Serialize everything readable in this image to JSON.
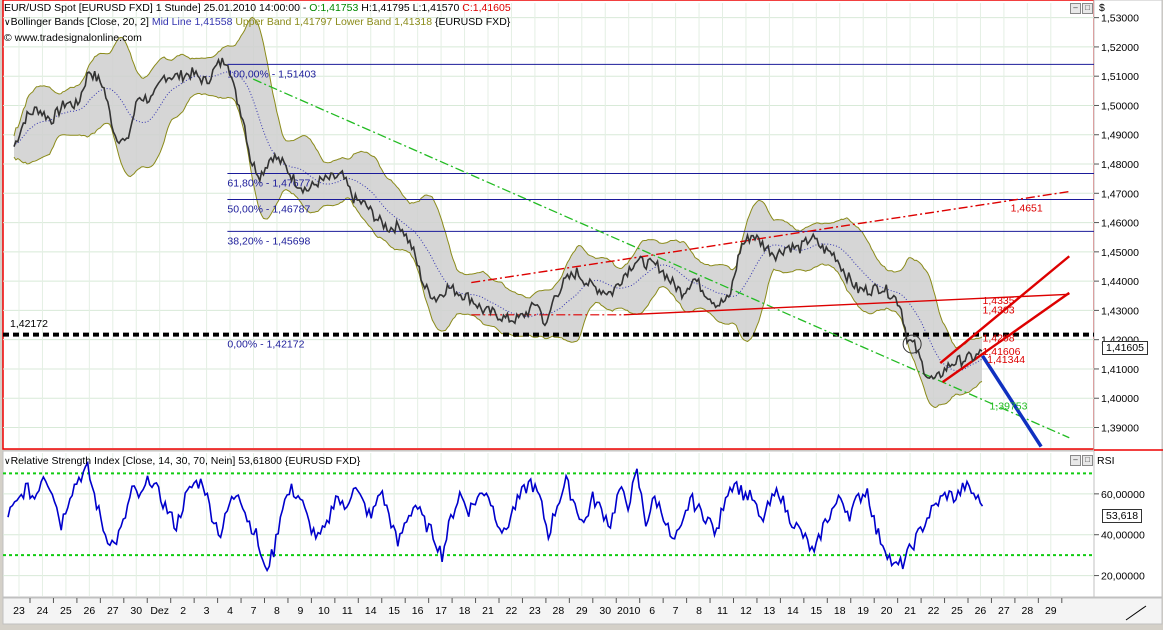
{
  "colors": {
    "price": "#333333",
    "band_fill": "#cfcfcf",
    "band_line": "#8b8b1a",
    "mid_line": "#3535b0",
    "fib_line": "#1b1b9a",
    "fib_text": "#1b1b9a",
    "red": "#dd0000",
    "green_dash": "#22bb22",
    "rsi": "#0000cc",
    "rsi_levels": "#11cc11",
    "blue_arrow": "#1030c0",
    "frame_red": "#ee0000"
  },
  "header": {
    "title_line": "EUR/USD Spot [EURUSD FXD]  1 Stunde] 25.01.2010 14:00:00 - ",
    "o_label": "O:",
    "o_value": "1,41753",
    "h_text": " H:1,41795 L:1,41570 ",
    "c_label": "C:",
    "c_value": "1,41605",
    "bb_prefix": "Bollinger Bands [Close, 20, 2] ",
    "bb_mid": "Mid Line 1,41558",
    "bb_upper": "Upper Band 1,41797",
    "bb_lower": "Lower Band 1,41318",
    "bb_suffix": " {EURUSD FXD}",
    "website": "www.tradesignalonline.com",
    "currency": "$"
  },
  "rsi_header": {
    "text": "Relative Strength Index [Close, 14, 30, 70, Nein] 53,61800 {EURUSD FXD}",
    "axis_title": "RSI"
  },
  "chart_data": [
    {
      "type": "line",
      "title": "EUR/USD Spot [EURUSD FXD] 1 Stunde",
      "ylim": [
        1.383,
        1.535
      ],
      "y_ticks": [
        "1,53000",
        "1,52000",
        "1,51000",
        "1,50000",
        "1,49000",
        "1,48000",
        "1,47000",
        "1,46000",
        "1,45000",
        "1,44000",
        "1,43000",
        "1,42000",
        "1,41000",
        "1,40000",
        "1,39000"
      ],
      "x_ticks": [
        "23",
        "24",
        "25",
        "26",
        "27",
        "30",
        "Dez",
        "2",
        "3",
        "4",
        "7",
        "8",
        "9",
        "10",
        "11",
        "14",
        "15",
        "16",
        "17",
        "18",
        "21",
        "22",
        "23",
        "28",
        "29",
        "30",
        "2010",
        "6",
        "7",
        "8",
        "11",
        "12",
        "13",
        "14",
        "15",
        "18",
        "19",
        "20",
        "21",
        "22",
        "25",
        "26",
        "27",
        "28",
        "29"
      ],
      "last_price": "1,41605",
      "price_path": [
        [
          0,
          1.486
        ],
        [
          0.5,
          1.496
        ],
        [
          1,
          1.499
        ],
        [
          1.6,
          1.495
        ],
        [
          2.2,
          1.501
        ],
        [
          2.7,
          1.5
        ],
        [
          3.2,
          1.512
        ],
        [
          3.8,
          1.507
        ],
        [
          4.3,
          1.49
        ],
        [
          4.8,
          1.487
        ],
        [
          5.3,
          1.503
        ],
        [
          5.9,
          1.502
        ],
        [
          6.4,
          1.51
        ],
        [
          7,
          1.51
        ],
        [
          7.6,
          1.511
        ],
        [
          8.2,
          1.508
        ],
        [
          8.7,
          1.514
        ],
        [
          9.1,
          1.516
        ],
        [
          9.4,
          1.505
        ],
        [
          9.8,
          1.495
        ],
        [
          10.1,
          1.481
        ],
        [
          10.5,
          1.476
        ],
        [
          11,
          1.483
        ],
        [
          11.5,
          1.48
        ],
        [
          12,
          1.474
        ],
        [
          12.5,
          1.471
        ],
        [
          13,
          1.474
        ],
        [
          13.5,
          1.475
        ],
        [
          14,
          1.476
        ],
        [
          14.5,
          1.468
        ],
        [
          15,
          1.466
        ],
        [
          15.5,
          1.461
        ],
        [
          16,
          1.458
        ],
        [
          16.5,
          1.459
        ],
        [
          17,
          1.451
        ],
        [
          17.5,
          1.438
        ],
        [
          18,
          1.434
        ],
        [
          18.5,
          1.438
        ],
        [
          19,
          1.436
        ],
        [
          19.5,
          1.434
        ],
        [
          20,
          1.43
        ],
        [
          20.5,
          1.429
        ],
        [
          21,
          1.427
        ],
        [
          21.5,
          1.427
        ],
        [
          22,
          1.43
        ],
        [
          22.3,
          1.433
        ],
        [
          22.7,
          1.424
        ],
        [
          23,
          1.434
        ],
        [
          23.5,
          1.44
        ],
        [
          24,
          1.443
        ],
        [
          24.5,
          1.439
        ],
        [
          25,
          1.437
        ],
        [
          25.5,
          1.436
        ],
        [
          26,
          1.442
        ],
        [
          26.5,
          1.447
        ],
        [
          27,
          1.446
        ],
        [
          27.5,
          1.445
        ],
        [
          28,
          1.44
        ],
        [
          28.5,
          1.436
        ],
        [
          29,
          1.441
        ],
        [
          29.5,
          1.436
        ],
        [
          30,
          1.432
        ],
        [
          30.5,
          1.434
        ],
        [
          31,
          1.452
        ],
        [
          31.5,
          1.456
        ],
        [
          32,
          1.452
        ],
        [
          32.5,
          1.449
        ],
        [
          33,
          1.452
        ],
        [
          33.5,
          1.451
        ],
        [
          34,
          1.455
        ],
        [
          34.5,
          1.451
        ],
        [
          35,
          1.449
        ],
        [
          35.5,
          1.442
        ],
        [
          36,
          1.437
        ],
        [
          36.5,
          1.437
        ],
        [
          37,
          1.438
        ],
        [
          37.5,
          1.435
        ],
        [
          37.8,
          1.432
        ],
        [
          38.1,
          1.42
        ],
        [
          38.4,
          1.418
        ],
        [
          38.7,
          1.412
        ],
        [
          39,
          1.407
        ],
        [
          39.3,
          1.406
        ],
        [
          39.6,
          1.409
        ],
        [
          40,
          1.412
        ],
        [
          40.4,
          1.413
        ],
        [
          40.8,
          1.414
        ],
        [
          41,
          1.414
        ],
        [
          41.3,
          1.416
        ]
      ],
      "fibonacci_levels": [
        {
          "label": "100,00% - 1,51403",
          "value": 1.51403
        },
        {
          "label": "61,80% - 1,47677",
          "value": 1.47677
        },
        {
          "label": "50,00% - 1,46787",
          "value": 1.46787
        },
        {
          "label": "38,20% - 1,45698",
          "value": 1.45698
        },
        {
          "label": "0,00% - 1,42172",
          "value": 1.42172
        }
      ],
      "horizontal_level": {
        "label": "1,42172",
        "value": 1.42172
      },
      "annotations": [
        "1,4651",
        "1,4335",
        "1,4303",
        "1,4208",
        "1,41606",
        "1,41344",
        "1,39753"
      ],
      "green_trendline": {
        "from": [
          10.2,
          1.509
        ],
        "to": [
          45,
          1.3865
        ]
      },
      "red_dashdot_line": {
        "from": [
          19.5,
          1.4395
        ],
        "to": [
          45,
          1.4706
        ]
      },
      "red_channel_line": {
        "from": [
          26,
          1.4285
        ],
        "to": [
          45,
          1.4355
        ]
      },
      "red_bold_upper": {
        "from": [
          39.5,
          1.412
        ],
        "to": [
          45,
          1.4485
        ]
      },
      "red_bold_lower": {
        "from": [
          39.6,
          1.4055
        ],
        "to": [
          45,
          1.436
        ]
      },
      "blue_arrow": {
        "from": [
          41.3,
          1.4145
        ],
        "to": [
          43.8,
          1.3835
        ]
      }
    },
    {
      "type": "line",
      "title": "Relative Strength Index [Close, 14, 30, 70, Nein]",
      "ylim": [
        10,
        80
      ],
      "y_ticks": [
        "60,00000",
        "40,00000",
        "20,00000"
      ],
      "levels": [
        30,
        70
      ],
      "last_value": "53,618",
      "values": [
        50,
        55,
        63,
        58,
        70,
        62,
        45,
        60,
        68,
        72,
        55,
        40,
        35,
        45,
        62,
        58,
        68,
        60,
        52,
        44,
        58,
        65,
        66,
        50,
        40,
        55,
        62,
        48,
        40,
        22,
        32,
        55,
        62,
        58,
        45,
        38,
        44,
        60,
        52,
        64,
        56,
        48,
        62,
        50,
        35,
        48,
        55,
        46,
        40,
        30,
        48,
        60,
        52,
        58,
        62,
        50,
        40,
        52,
        60,
        66,
        58,
        40,
        55,
        66,
        55,
        45,
        58,
        52,
        45,
        62,
        55,
        70,
        46,
        58,
        50,
        36,
        42,
        58,
        52,
        48,
        40,
        60,
        66,
        60,
        58,
        46,
        55,
        62,
        50,
        44,
        38,
        30,
        44,
        52,
        58,
        50,
        58,
        62,
        42,
        34,
        24,
        26,
        34,
        42,
        50,
        56,
        60,
        58,
        64,
        60,
        54
      ]
    }
  ]
}
